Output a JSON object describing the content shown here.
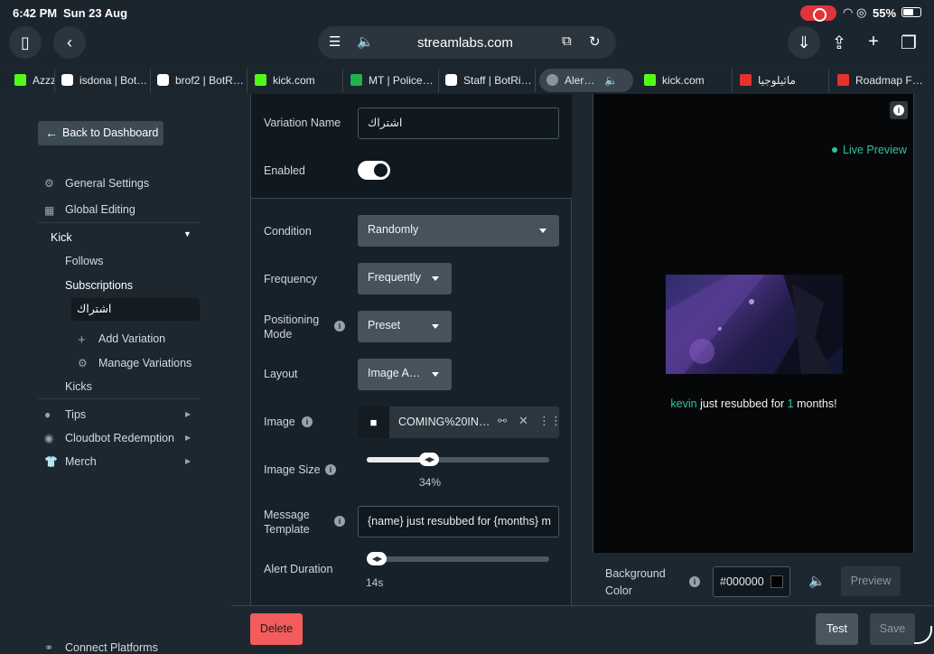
{
  "status_bar": {
    "time": "6:42 PM",
    "date": "Sun 23 Aug",
    "battery": "55%"
  },
  "browser": {
    "url": "streamlabs.com",
    "tabs": [
      {
        "label": "Azzz",
        "favicon": "kick"
      },
      {
        "label": "isdona | Bot…",
        "favicon": "botrix"
      },
      {
        "label": "brof2 | BotR…",
        "favicon": "botrix"
      },
      {
        "label": "kick.com",
        "favicon": "kick"
      },
      {
        "label": "MT | Police…",
        "favicon": "mt"
      },
      {
        "label": "Staff | BotRi…",
        "favicon": "botrix"
      },
      {
        "label": "Aler…",
        "favicon": "close",
        "active": true
      },
      {
        "label": "kick.com",
        "favicon": "kick"
      },
      {
        "label": "ماثيلوجيا",
        "favicon": "red"
      },
      {
        "label": "Roadmap F…",
        "favicon": "red"
      }
    ]
  },
  "sidebar": {
    "back_label": "Back to Dashboard",
    "general_settings": "General Settings",
    "global_editing": "Global Editing",
    "kick": "Kick",
    "follows": "Follows",
    "subscriptions": "Subscriptions",
    "variation": "اشتراك",
    "add_variation": "Add Variation",
    "manage_variations": "Manage Variations",
    "kicks": "Kicks",
    "tips": "Tips",
    "cloudbot": "Cloudbot Redemption",
    "merch": "Merch",
    "connect": "Connect Platforms"
  },
  "form": {
    "variation_name_label": "Variation Name",
    "variation_name_value": "اشتراك",
    "enabled_label": "Enabled",
    "enabled": true,
    "condition_label": "Condition",
    "condition_value": "Randomly",
    "frequency_label": "Frequency",
    "frequency_value": "Frequently",
    "positioning_label_1": "Positioning",
    "positioning_label_2": "Mode",
    "positioning_value": "Preset",
    "layout_label": "Layout",
    "layout_value": "Image A…",
    "image_label": "Image",
    "image_value": "COMING%20IN…",
    "image_size_label": "Image Size",
    "image_size_value": "34%",
    "image_size_fraction": 0.34,
    "message_label_1": "Message",
    "message_label_2": "Template",
    "message_value": "{name} just resubbed for {months} m",
    "duration_label": "Alert Duration",
    "duration_value": "14s",
    "duration_fraction": 0.05
  },
  "preview": {
    "live_label": "Live Preview",
    "name": "kevin",
    "msg_mid": " just resubbed for ",
    "months": "1",
    "msg_end": " months!",
    "bg_label_1": "Background",
    "bg_label_2": "Color",
    "bg_color": "#000000",
    "preview_button": "Preview"
  },
  "footer": {
    "delete": "Delete",
    "test": "Test",
    "save": "Save"
  },
  "colors": {
    "accent": "#31c3a2",
    "danger": "#f25c5c",
    "panel": "#17212a"
  }
}
